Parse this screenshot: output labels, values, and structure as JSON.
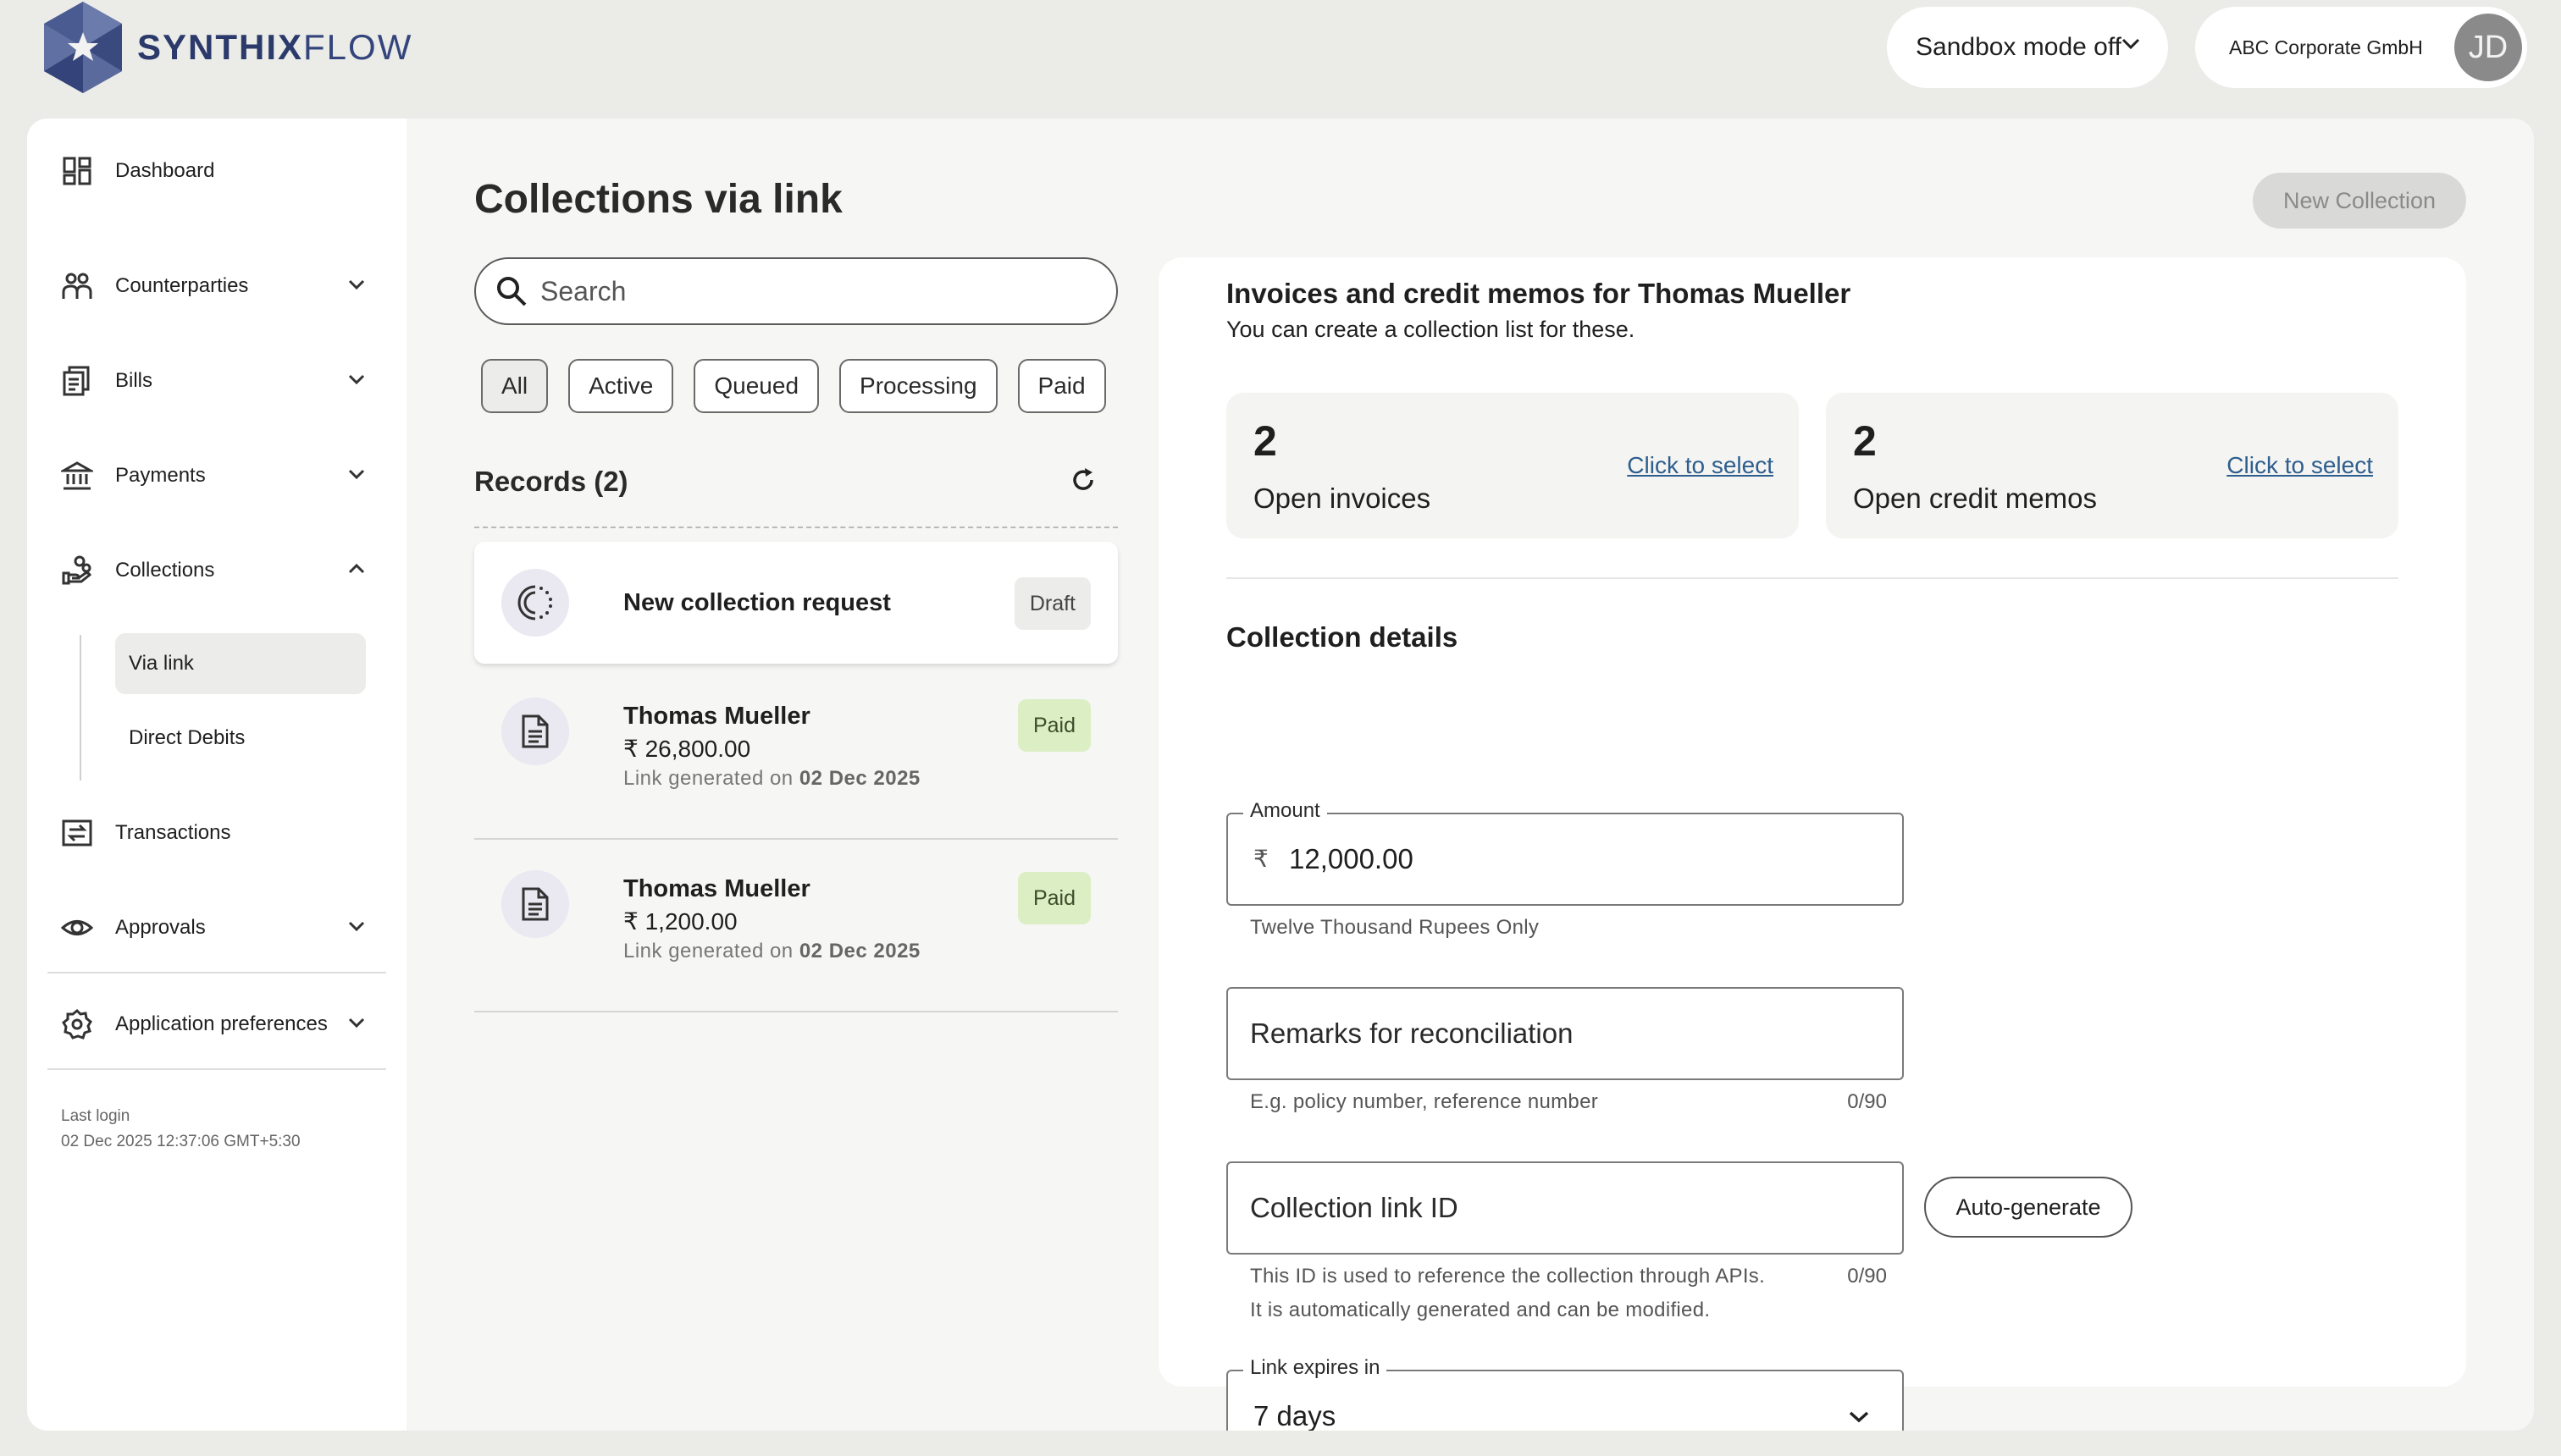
{
  "brand": {
    "logo_bold": "SYNTHIX",
    "logo_light": "FLOW"
  },
  "header": {
    "sandbox_label": "Sandbox mode off",
    "account_name": "ABC Corporate GmbH",
    "avatar_initials": "JD"
  },
  "sidebar": {
    "items": [
      {
        "label": "Dashboard"
      },
      {
        "label": "Counterparties"
      },
      {
        "label": "Bills"
      },
      {
        "label": "Payments"
      },
      {
        "label": "Collections"
      },
      {
        "label": "Transactions"
      },
      {
        "label": "Approvals"
      },
      {
        "label": "Application preferences"
      }
    ],
    "collections_sub": [
      {
        "label": "Via link",
        "active": true
      },
      {
        "label": "Direct Debits",
        "active": false
      }
    ],
    "last_login_label": "Last login",
    "last_login_value": "02 Dec 2025 12:37:06 GMT+5:30"
  },
  "main": {
    "title": "Collections via link",
    "new_collection_label": "New Collection",
    "search_placeholder": "Search",
    "filters": [
      "All",
      "Active",
      "Queued",
      "Processing",
      "Paid"
    ],
    "active_filter": "All",
    "records_title": "Records (2)",
    "draft": {
      "title": "New collection request",
      "status": "Draft"
    },
    "records": [
      {
        "name": "Thomas Mueller",
        "amount": "₹ 26,800.00",
        "gen_prefix": "Link generated on",
        "gen_date": "02 Dec 2025",
        "status": "Paid"
      },
      {
        "name": "Thomas Mueller",
        "amount": "₹ 1,200.00",
        "gen_prefix": "Link generated on",
        "gen_date": "02 Dec 2025",
        "status": "Paid"
      }
    ]
  },
  "panel": {
    "title": "Invoices and credit memos for Thomas Mueller",
    "subtitle": "You can create a collection list for these.",
    "stats": [
      {
        "count": "2",
        "label": "Open invoices",
        "link": "Click to select"
      },
      {
        "count": "2",
        "label": "Open credit memos",
        "link": "Click to select"
      }
    ],
    "section_title": "Collection details",
    "amount": {
      "label": "Amount",
      "currency": "₹",
      "value": "12,000.00",
      "helper": "Twelve Thousand Rupees Only"
    },
    "remarks": {
      "placeholder": "Remarks for reconciliation",
      "helper": "E.g. policy number, reference number",
      "counter": "0/90"
    },
    "link_id": {
      "placeholder": "Collection link ID",
      "helper_line1": "This ID is used to reference the collection through APIs.",
      "helper_line2": "It is automatically generated and can be modified.",
      "counter": "0/90",
      "autogen_label": "Auto-generate"
    },
    "expiry": {
      "label": "Link expires in",
      "value": "7 days"
    }
  }
}
